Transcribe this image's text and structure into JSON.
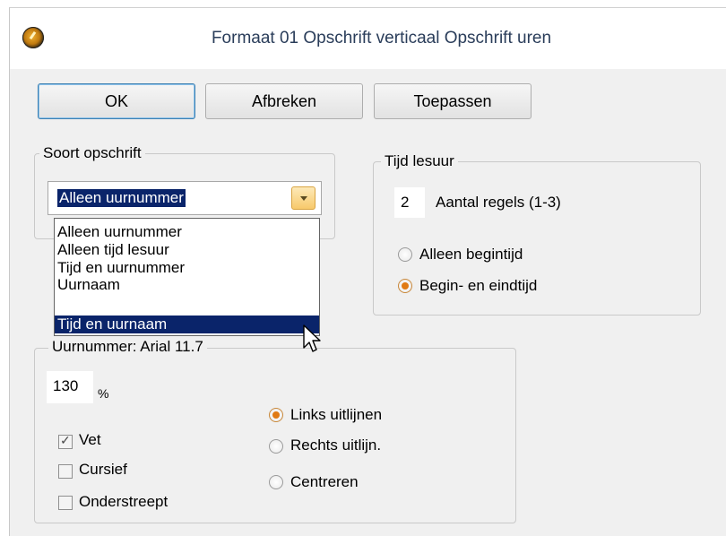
{
  "window": {
    "title": "Formaat 01  Opschrift verticaal  Opschrift uren"
  },
  "buttons": {
    "ok": "OK",
    "cancel": "Afbreken",
    "apply": "Toepassen"
  },
  "soort": {
    "label": "Soort opschrift",
    "selected": "Alleen uurnummer",
    "options": [
      "Alleen uurnummer",
      "Alleen tijd lesuur",
      "Tijd en uurnummer",
      "Uurnaam",
      "Tijd en uurnaam"
    ],
    "highlighted": "Tijd en uurnaam"
  },
  "tijd": {
    "label": "Tijd lesuur",
    "lines_value": "2",
    "lines_label": "Aantal regels (1-3)",
    "radio_begin": "Alleen begintijd",
    "radio_begin_end": "Begin- en eindtijd",
    "selected": "Begin- en eindtijd"
  },
  "uur": {
    "label": "Uurnummer: Arial 11.7",
    "size_value": "130",
    "size_unit": "%",
    "vet": "Vet",
    "cursief": "Cursief",
    "onderstreept": "Onderstreept",
    "vet_checked": true,
    "cursief_checked": false,
    "onderstreept_checked": false,
    "align_left": "Links uitlijnen",
    "align_right": "Rechts uitlijn.",
    "align_center": "Centreren",
    "align_selected": "Links uitlijnen"
  }
}
